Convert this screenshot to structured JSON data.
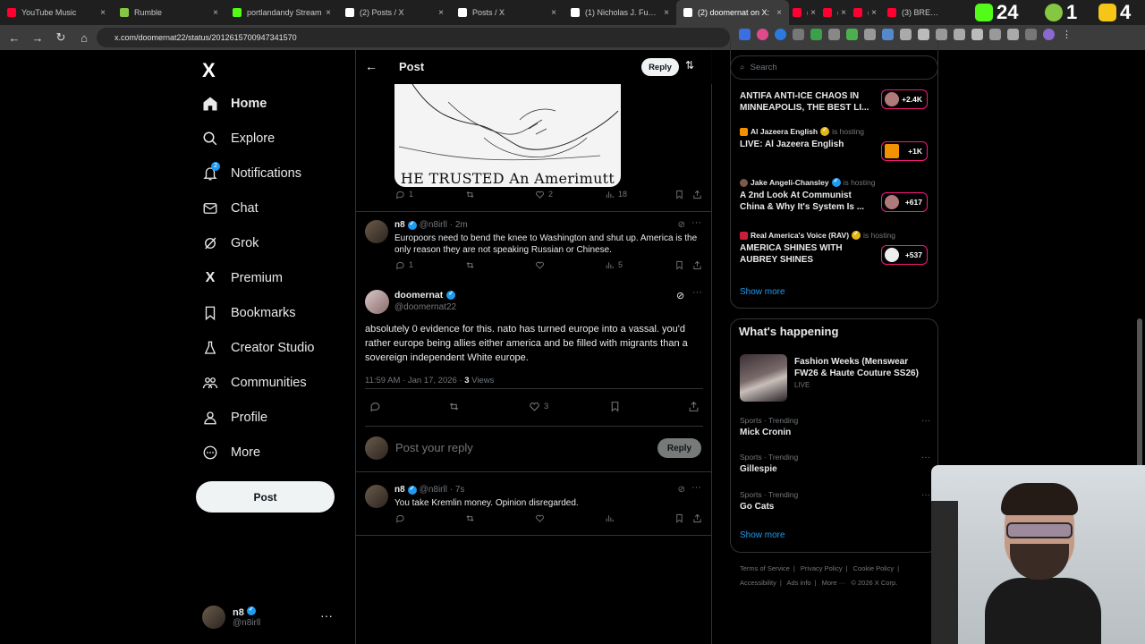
{
  "browser": {
    "tabs": [
      {
        "title": "YouTube Music",
        "color": "#ff0033",
        "active": false
      },
      {
        "title": "Rumble",
        "color": "#85c742",
        "active": false
      },
      {
        "title": "portlandandy Stream",
        "color": "#53fc18",
        "active": false
      },
      {
        "title": "(2) Posts / X",
        "color": "#ffffff",
        "active": false
      },
      {
        "title": "Posts / X",
        "color": "#ffffff",
        "active": false
      },
      {
        "title": "(1) Nicholas J. Fuente",
        "color": "#ffffff",
        "active": false
      },
      {
        "title": "(2) doomernat on X:",
        "color": "#ffffff",
        "active": true
      },
      {
        "title": "(2)",
        "color": "#ff0033",
        "active": false
      },
      {
        "title": "(2)",
        "color": "#ff0033",
        "active": false
      },
      {
        "title": "(2) K",
        "color": "#ff0033",
        "active": false
      },
      {
        "title": "(3) BREAKING: L",
        "color": "#ff0033",
        "active": false
      }
    ],
    "counts": [
      {
        "value": "24",
        "color": "#53fc18"
      },
      {
        "value": "1",
        "color": "#85c742"
      },
      {
        "value": "4",
        "color": "#f5c518"
      }
    ],
    "url": "x.com/doomernat22/status/2012615700947341570"
  },
  "nav": {
    "logo": "X",
    "notif_count": "2",
    "items": [
      "Home",
      "Explore",
      "Notifications",
      "Chat",
      "Grok",
      "Premium",
      "Bookmarks",
      "Creator Studio",
      "Communities",
      "Profile",
      "More"
    ],
    "post_button": "Post",
    "account": {
      "name": "n8",
      "handle": "@n8irll",
      "more": "···"
    }
  },
  "header": {
    "title": "Post",
    "reply_button": "Reply"
  },
  "image_caption": "HE TRUSTED An Amerimutt",
  "parent_actions": {
    "replies": "1",
    "likes": "2",
    "views": "18"
  },
  "reply1": {
    "name": "n8",
    "meta": "@n8irll · 2m",
    "text": "Europoors need to bend the knee to Washington and shut up. America is the only reason they are not speaking Russian or Chinese.",
    "replies": "1",
    "views": "5"
  },
  "main_post": {
    "name": "doomernat",
    "handle": "@doomernat22",
    "text": "absolutely 0 evidence for this. nato has turned europe into a vassal. you'd rather europe being allies either america and be filled with migrants than a sovereign independent White europe.",
    "time": "11:59 AM · Jan 17, 2026 · ",
    "views_count": "3",
    "views_label": " Views",
    "likes": "3"
  },
  "composer": {
    "placeholder": "Post your reply",
    "button": "Reply"
  },
  "reply2": {
    "name": "n8",
    "meta": "@n8irll · 7s",
    "text": "You take Kremlin money. Opinion disregarded."
  },
  "right": {
    "search_placeholder": "Search",
    "live": [
      {
        "host": "",
        "status": "",
        "title": "ANTIFA ANTI-ICE CHAOS IN MINNEAPOLIS, THE BEST LI...",
        "count": "+2.4K",
        "host_color": "#444"
      },
      {
        "host": "Al Jazeera English",
        "status": "is hosting",
        "title": "LIVE: Al Jazeera English",
        "count": "+1K",
        "host_color": "#f39200"
      },
      {
        "host": "Jake Angeli-Chansley",
        "status": "is hosting",
        "title": "A 2nd Look At Communist China & Why It's System Is ...",
        "count": "+617",
        "host_color": "#7a5a4a"
      },
      {
        "host": "Real America's Voice (RAV)",
        "status": "is hosting",
        "title": "AMERICA SHINES WITH AUBREY SHINES",
        "count": "+537",
        "host_color": "#c81e3a"
      }
    ],
    "show_more": "Show more",
    "whats_happening": "What's happening",
    "fashion": {
      "title": "Fashion Weeks (Menswear FW26 & Haute Couture SS26)",
      "status": "LIVE"
    },
    "trends": [
      {
        "category": "Sports · Trending",
        "name": "Mick Cronin"
      },
      {
        "category": "Sports · Trending",
        "name": "Gillespie"
      },
      {
        "category": "Sports · Trending",
        "name": "Go Cats"
      }
    ],
    "show_more2": "Show more",
    "footer": [
      "Terms of Service",
      "|",
      "Privacy Policy",
      "|",
      "Cookie Policy",
      "|",
      "Accessibility",
      "|",
      "Ads info",
      "|",
      "More ···",
      "© 2026 X Corp."
    ]
  }
}
